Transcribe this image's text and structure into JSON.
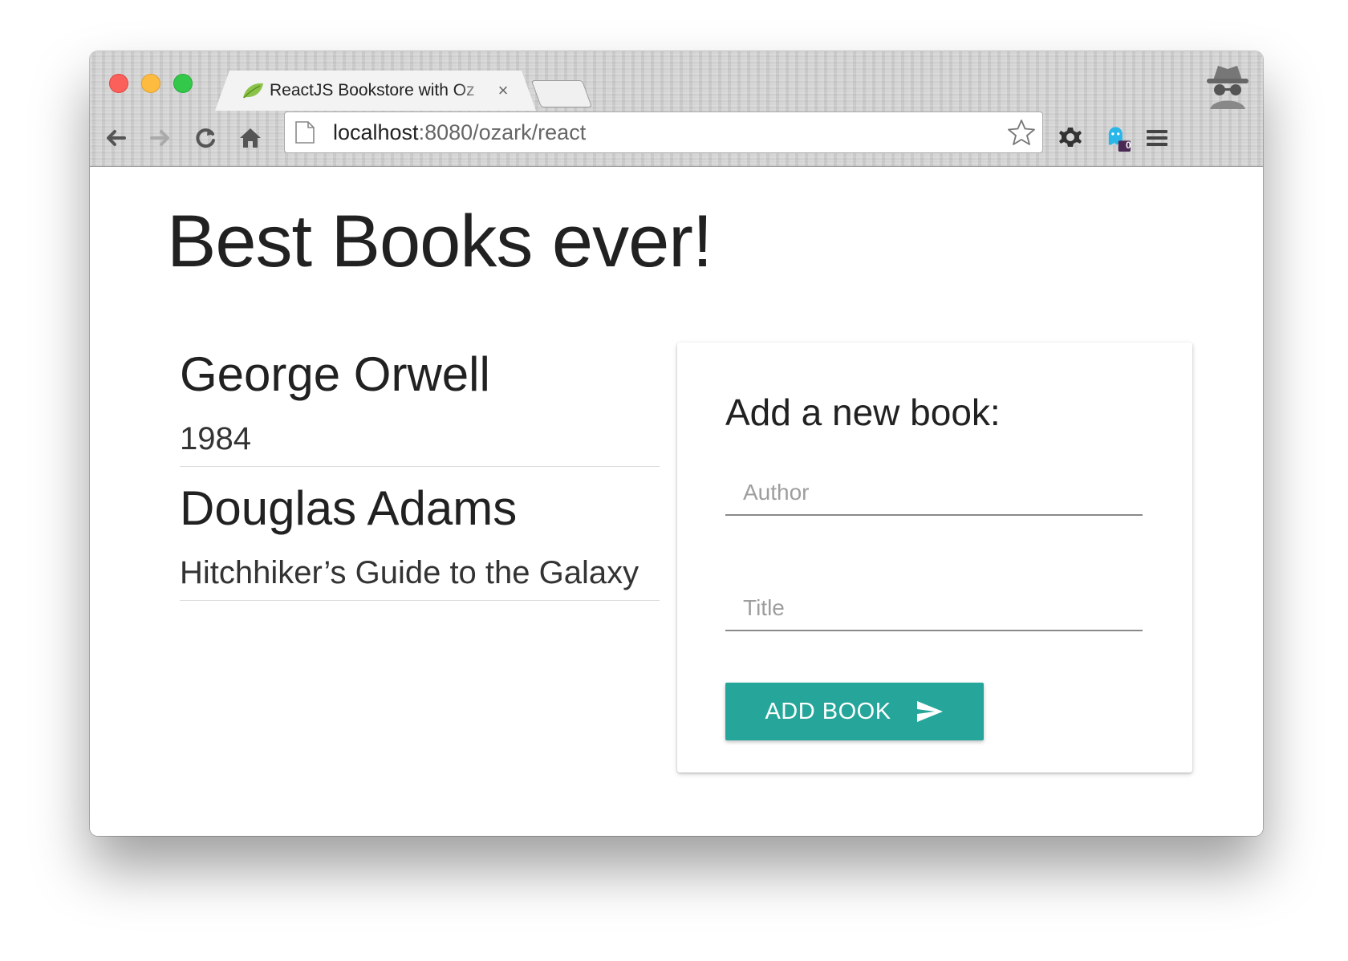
{
  "browser": {
    "tab_title": "ReactJS Bookstore with Oz",
    "tab_close": "×",
    "url_host": "localhost",
    "url_rest": ":8080/ozark/react",
    "extension_badge": "0"
  },
  "page": {
    "headline": "Best Books ever!",
    "books": [
      {
        "author": "George Orwell",
        "title": "1984"
      },
      {
        "author": "Douglas Adams",
        "title": "Hitchhiker’s Guide to the Galaxy"
      }
    ],
    "form": {
      "heading": "Add a new book:",
      "author_placeholder": "Author",
      "title_placeholder": "Title",
      "submit_label": "ADD BOOK"
    }
  },
  "colors": {
    "accent": "#26a69a",
    "traffic_close": "#fc605b",
    "traffic_min": "#fdbc40",
    "traffic_max": "#34c84a"
  },
  "icons": [
    "back-icon",
    "forward-icon",
    "reload-icon",
    "home-icon",
    "page-icon",
    "star-icon",
    "gear-icon",
    "ghostery-icon",
    "menu-icon",
    "incognito-icon",
    "send-icon",
    "leaf-favicon"
  ]
}
